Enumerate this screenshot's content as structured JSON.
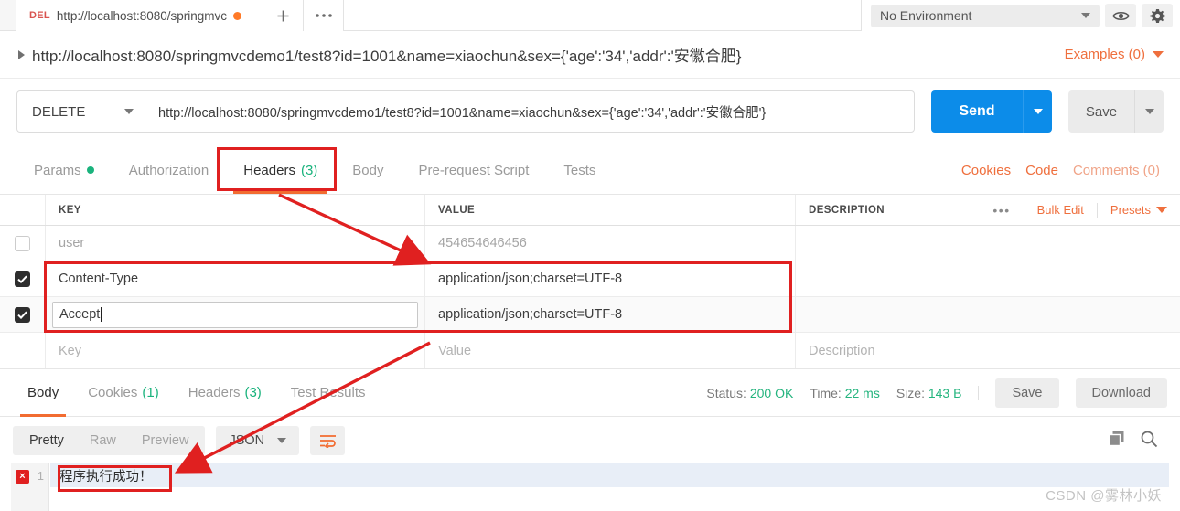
{
  "window": {
    "tab": {
      "method_label": "DEL",
      "title": "http://localhost:8080/springmvc",
      "unsaved": true
    },
    "new_tab_icon": "plus-icon",
    "more_tabs_icon": "ellipsis-icon",
    "environment": {
      "selected": "No Environment",
      "eye_icon": "eye-icon",
      "settings_icon": "gear-icon"
    }
  },
  "request": {
    "name": "http://localhost:8080/springmvcdemo1/test8?id=1001&name=xiaochun&sex={'age':'34','addr':'安徽合肥}",
    "examples_label": "Examples (0)",
    "method": "DELETE",
    "url": "http://localhost:8080/springmvcdemo1/test8?id=1001&name=xiaochun&sex={'age':'34','addr':'安徽合肥'}",
    "send_label": "Send",
    "save_label": "Save",
    "tabs": [
      {
        "label": "Params",
        "badge": "",
        "dot": true,
        "active": false
      },
      {
        "label": "Authorization",
        "badge": "",
        "dot": false,
        "active": false
      },
      {
        "label": "Headers",
        "badge": "(3)",
        "dot": false,
        "active": true
      },
      {
        "label": "Body",
        "badge": "",
        "dot": false,
        "active": false
      },
      {
        "label": "Pre-request Script",
        "badge": "",
        "dot": false,
        "active": false
      },
      {
        "label": "Tests",
        "badge": "",
        "dot": false,
        "active": false
      }
    ],
    "right_links": {
      "cookies": "Cookies",
      "code": "Code",
      "comments": "Comments (0)"
    }
  },
  "headers_table": {
    "columns": {
      "key": "KEY",
      "value": "VALUE",
      "description": "DESCRIPTION"
    },
    "actions": {
      "more": "•••",
      "bulk_edit": "Bulk Edit",
      "presets": "Presets"
    },
    "rows": [
      {
        "checked": false,
        "key": "user",
        "value": "454654646456",
        "description": "",
        "muted": true,
        "editing": false
      },
      {
        "checked": true,
        "key": "Content-Type",
        "value": "application/json;charset=UTF-8",
        "description": "",
        "muted": false,
        "editing": false
      },
      {
        "checked": true,
        "key": "Accept",
        "value": "application/json;charset=UTF-8",
        "description": "",
        "muted": false,
        "editing": true
      }
    ],
    "placeholder_row": {
      "key": "Key",
      "value": "Value",
      "description": "Description"
    }
  },
  "response": {
    "tabs": [
      {
        "label": "Body",
        "badge": "",
        "active": true
      },
      {
        "label": "Cookies",
        "badge": "(1)",
        "active": false
      },
      {
        "label": "Headers",
        "badge": "(3)",
        "active": false
      },
      {
        "label": "Test Results",
        "badge": "",
        "active": false
      }
    ],
    "status_label": "Status:",
    "status_value": "200 OK",
    "time_label": "Time:",
    "time_value": "22 ms",
    "size_label": "Size:",
    "size_value": "143 B",
    "save_label": "Save",
    "download_label": "Download",
    "view_modes": [
      {
        "label": "Pretty",
        "active": true
      },
      {
        "label": "Raw",
        "active": false
      },
      {
        "label": "Preview",
        "active": false
      }
    ],
    "format": "JSON",
    "wrap_icon": "word-wrap-icon",
    "copy_icon": "copy-icon",
    "search_icon": "search-icon",
    "body": {
      "error_marker": "×",
      "line_number": "1",
      "content": "程序执行成功！"
    }
  },
  "watermark": "CSDN @雾林小妖",
  "colors": {
    "accent_orange": "#f26c31",
    "send_blue": "#0c8ce9",
    "success_green": "#24b47e",
    "annotation_red": "#e02020",
    "method_delete": "#d9534f"
  }
}
